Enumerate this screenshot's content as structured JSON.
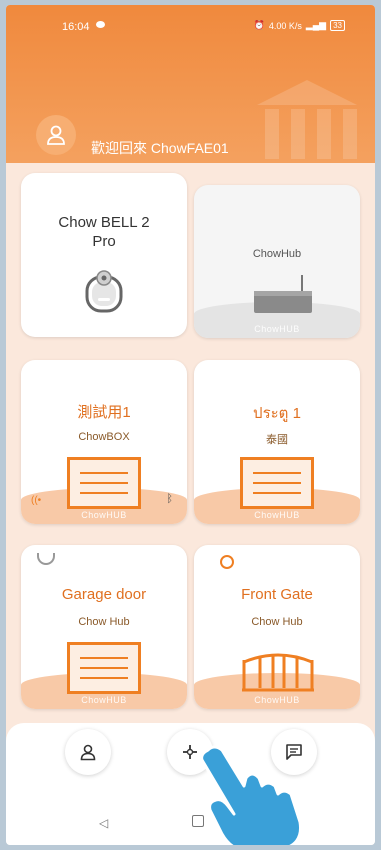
{
  "status_bar": {
    "time": "16:04",
    "right_text": "4.00 K/s",
    "battery": "33"
  },
  "header": {
    "welcome": "歡迎回來 ChowFAE01"
  },
  "devices": [
    {
      "title": "Chow BELL 2 Pro"
    },
    {
      "title": "ChowHub",
      "watermark": "ChowHUB"
    },
    {
      "title": "測試用1",
      "subtitle": "ChowBOX",
      "watermark": "ChowHUB"
    },
    {
      "title": "ประตู 1",
      "subtitle": "泰國",
      "watermark": "ChowHUB"
    },
    {
      "title": "Garage door",
      "subtitle": "Chow Hub",
      "watermark": "ChowHUB"
    },
    {
      "title": "Front Gate",
      "subtitle": "Chow Hub",
      "watermark": "ChowHUB"
    }
  ],
  "bottom_nav": [
    {
      "icon": "user-icon"
    },
    {
      "icon": "add-device-icon"
    },
    {
      "icon": "message-icon"
    }
  ],
  "colors": {
    "accent": "#ef7f22",
    "header": "#f0893d",
    "background": "#fbe8dc"
  }
}
